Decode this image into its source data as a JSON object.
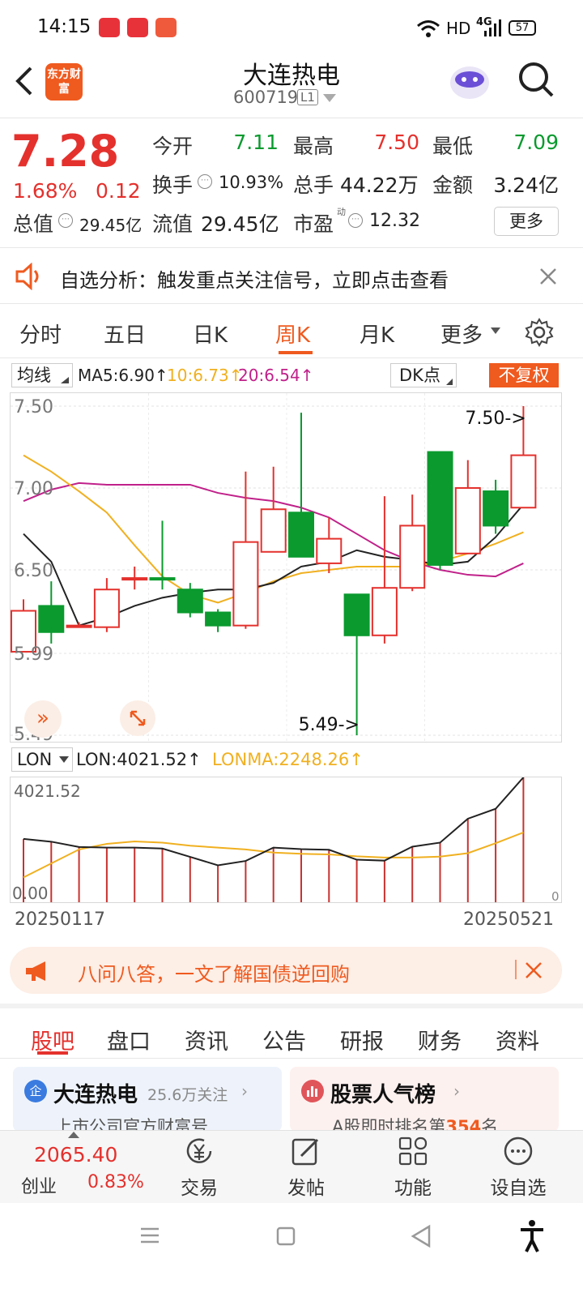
{
  "status": {
    "time": "14:15",
    "network": "HD",
    "signal": "4G",
    "battery": "57"
  },
  "header": {
    "title": "大连热电",
    "code": "600719",
    "level": "L1",
    "logo_text": "东方财富"
  },
  "quote": {
    "price": "7.28",
    "change_pct": "1.68%",
    "change": "0.12",
    "open_label": "今开",
    "open": "7.11",
    "high_label": "最高",
    "high": "7.50",
    "low_label": "最低",
    "low": "7.09",
    "turnover_label": "换手",
    "turnover": "10.93%",
    "volume_label": "总手",
    "volume": "44.22万",
    "amount_label": "金额",
    "amount": "3.24亿",
    "mktcap_label": "总值",
    "mktcap": "29.45亿",
    "float_label": "流值",
    "float_cap": "29.45亿",
    "pe_label": "市盈",
    "pe_sup": "动",
    "pe": "12.32",
    "more": "更多"
  },
  "notice": {
    "text": "自选分析：触发重点关注信号，立即点击查看"
  },
  "ktabs": [
    "分时",
    "五日",
    "日K",
    "周K",
    "月K",
    "更多"
  ],
  "ma": {
    "label": "均线",
    "ma5": "MA5:6.90↑",
    "ma10": "10:6.73↑",
    "ma20": "20:6.54↑",
    "dk": "DK点",
    "adjust": "不复权"
  },
  "colors": {
    "up": "#e4312d",
    "down": "#0a9a2e",
    "accent": "#ef5a1f",
    "ma5": "#222222",
    "ma10": "#f0b020",
    "ma20": "#c0218a"
  },
  "chart_data": {
    "type": "candlestick",
    "y_ticks": [
      "7.50",
      "7.00",
      "6.50",
      "5.99",
      "5.49"
    ],
    "ylim": [
      5.49,
      7.5
    ],
    "high_label": "7.50->",
    "low_label": "5.49->",
    "candles": [
      {
        "o": 6.0,
        "c": 6.25,
        "h": 6.32,
        "l": 6.0
      },
      {
        "o": 6.28,
        "c": 6.12,
        "h": 6.43,
        "l": 6.05
      },
      {
        "o": 6.15,
        "c": 6.16,
        "h": 6.18,
        "l": 6.15
      },
      {
        "o": 6.15,
        "c": 6.38,
        "h": 6.45,
        "l": 6.12
      },
      {
        "o": 6.45,
        "c": 6.45,
        "h": 6.52,
        "l": 6.38
      },
      {
        "o": 6.45,
        "c": 6.44,
        "h": 6.8,
        "l": 6.38
      },
      {
        "o": 6.38,
        "c": 6.24,
        "h": 6.42,
        "l": 6.21
      },
      {
        "o": 6.24,
        "c": 6.16,
        "h": 6.26,
        "l": 6.12
      },
      {
        "o": 6.16,
        "c": 6.67,
        "h": 7.1,
        "l": 6.14
      },
      {
        "o": 6.61,
        "c": 6.87,
        "h": 7.13,
        "l": 6.61
      },
      {
        "o": 6.85,
        "c": 6.58,
        "h": 7.46,
        "l": 6.58
      },
      {
        "o": 6.54,
        "c": 6.69,
        "h": 6.82,
        "l": 6.48
      },
      {
        "o": 6.35,
        "c": 6.1,
        "h": 6.35,
        "l": 5.49
      },
      {
        "o": 6.1,
        "c": 6.39,
        "h": 6.95,
        "l": 6.05
      },
      {
        "o": 6.39,
        "c": 6.77,
        "h": 6.96,
        "l": 6.37
      },
      {
        "o": 7.22,
        "c": 6.53,
        "h": 7.22,
        "l": 6.5
      },
      {
        "o": 6.6,
        "c": 7.0,
        "h": 7.17,
        "l": 6.6
      },
      {
        "o": 6.98,
        "c": 6.77,
        "h": 7.05,
        "l": 6.72
      },
      {
        "o": 6.88,
        "c": 7.2,
        "h": 7.5,
        "l": 6.88
      }
    ],
    "ma5": [
      6.72,
      6.55,
      6.16,
      6.21,
      6.28,
      6.33,
      6.36,
      6.38,
      6.38,
      6.42,
      6.52,
      6.55,
      6.62,
      6.58,
      6.56,
      6.53,
      6.55,
      6.7,
      6.9
    ],
    "ma10": [
      7.2,
      7.1,
      6.98,
      6.85,
      6.65,
      6.46,
      6.35,
      6.3,
      6.36,
      6.43,
      6.48,
      6.5,
      6.52,
      6.52,
      6.52,
      6.55,
      6.6,
      6.66,
      6.73
    ],
    "ma20": [
      6.92,
      6.99,
      7.03,
      7.02,
      7.02,
      7.02,
      7.02,
      6.97,
      6.94,
      6.92,
      6.88,
      6.82,
      6.72,
      6.62,
      6.55,
      6.5,
      6.47,
      6.46,
      6.54
    ]
  },
  "lon": {
    "label": "LON",
    "value": "LON:4021.52↑",
    "ma": "LONMA:2248.26↑",
    "max_tick": "4021.52",
    "min_tick": "0.00",
    "right_zero": "0",
    "date_start": "20250117",
    "date_end": "20250521",
    "ymax": 4021.52,
    "bars": [
      2040,
      1950,
      1780,
      1760,
      1760,
      1730,
      1460,
      1190,
      1330,
      1760,
      1710,
      1690,
      1370,
      1340,
      1790,
      1920,
      2690,
      3010,
      4021.52
    ],
    "lonma": [
      800,
      1250,
      1700,
      1880,
      1960,
      1920,
      1820,
      1760,
      1700,
      1600,
      1560,
      1540,
      1480,
      1440,
      1440,
      1470,
      1580,
      1900,
      2248.26
    ]
  },
  "ad": {
    "text": "八问八答，一文了解国债逆回购"
  },
  "bottom_tabs": [
    "股吧",
    "盘口",
    "资讯",
    "公告",
    "研报",
    "财务",
    "资料"
  ],
  "cards": {
    "left_title": "大连热电",
    "left_follow": "25.6万关注",
    "left_sub": "上市公司官方财富号",
    "right_title": "股票人气榜",
    "right_sub_prefix": "A股即时排名第",
    "right_rank": "354",
    "right_sub_suffix": "名"
  },
  "toolbar": {
    "index_value": "2065.40",
    "index_name": "创业",
    "index_pct": "0.83%",
    "trade": "交易",
    "post": "发帖",
    "func": "功能",
    "watch": "设自选"
  }
}
